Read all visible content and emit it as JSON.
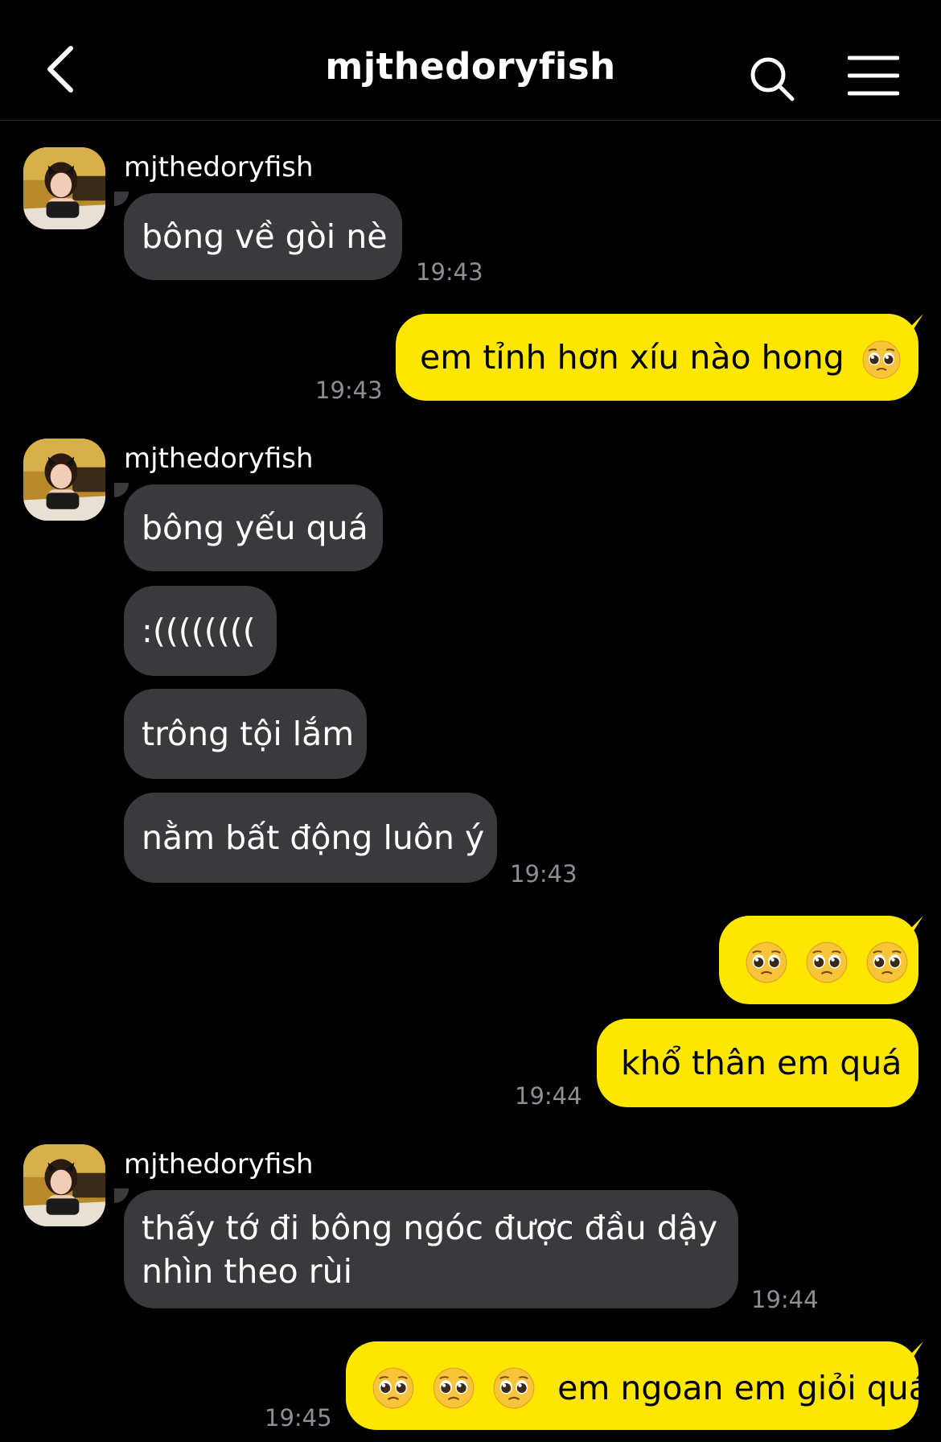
{
  "header": {
    "title": "mjthedoryfish"
  },
  "sender_name": "mjthedoryfish",
  "colors": {
    "background": "#000000",
    "incoming_bubble": "#3a3a3c",
    "outgoing_bubble": "#fde700",
    "timestamp": "#8e8e93"
  },
  "messages": {
    "m1": {
      "text": "bông về gòi nè",
      "time": "19:43"
    },
    "m2": {
      "text": "em tỉnh hơn xíu nào hong",
      "emoji": "pleading-face",
      "time": "19:43"
    },
    "m3": {
      "text": "bông yếu quá"
    },
    "m4": {
      "text": ":(((((((("
    },
    "m5": {
      "text": "trông tội lắm"
    },
    "m6": {
      "text": "nằm bất động luôn ý",
      "time": "19:43"
    },
    "m7": {
      "emoji": [
        "pleading-face",
        "pleading-face",
        "pleading-face"
      ]
    },
    "m8": {
      "text": "khổ thân em quá",
      "time": "19:44"
    },
    "m9": {
      "line1": "thấy tớ đi bông ngóc được đầu dậy",
      "line2": "nhìn theo rùi",
      "time": "19:44"
    },
    "m10": {
      "emoji": [
        "pleading-face",
        "pleading-face",
        "pleading-face"
      ],
      "text": "em ngoan em giỏi quá",
      "time": "19:45"
    }
  },
  "icons": {
    "back": "chevron-left-icon",
    "search": "search-icon",
    "menu": "hamburger-menu-icon",
    "avatar": "profile-avatar"
  }
}
